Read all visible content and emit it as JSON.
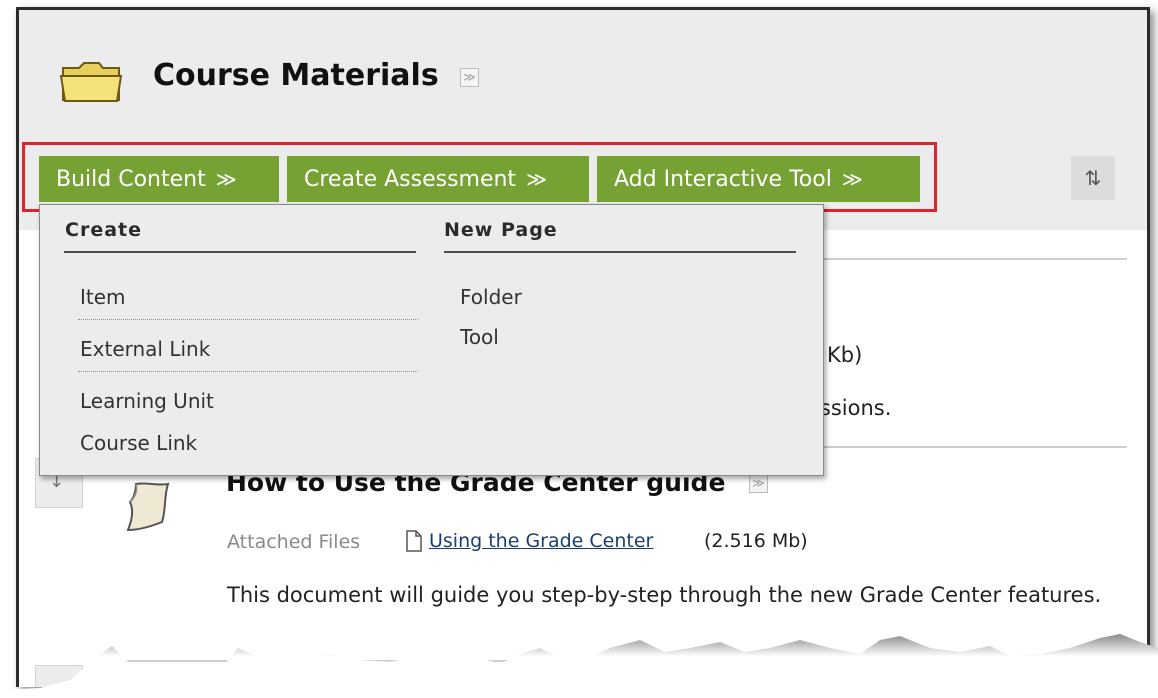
{
  "page": {
    "title": "Course Materials"
  },
  "toolbar": {
    "buttons": [
      {
        "label": "Build Content"
      },
      {
        "label": "Create Assessment"
      },
      {
        "label": "Add Interactive Tool"
      }
    ]
  },
  "dropdown": {
    "create_header": "Create",
    "create_items": [
      "Item",
      "External Link",
      "Learning Unit",
      "Course Link"
    ],
    "newpage_header": "New Page",
    "newpage_items": [
      "Folder",
      "Tool"
    ]
  },
  "behind": {
    "size_fragment": "Kb)",
    "sessions_fragment": "essions."
  },
  "content": {
    "item_title": "How to Use the Grade Center guide",
    "attached_label": "Attached Files",
    "file_name": "Using the Grade Center",
    "file_size": "(2.516 Mb)",
    "description": "This document will guide you step-by-step through the new Grade Center features."
  },
  "colors": {
    "button_green": "#76a234",
    "highlight_red": "#e3212e",
    "header_gray": "#ececec"
  }
}
